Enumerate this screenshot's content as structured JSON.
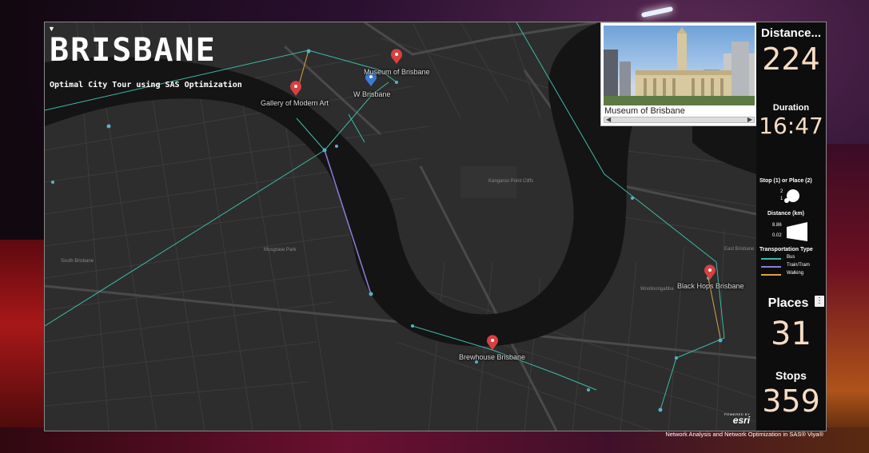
{
  "title": "BRISBANE",
  "subtitle": "Optimal City Tour using SAS Optimization",
  "footer": "Network Analysis and Network Optimization in SAS® Viya®",
  "photo_panel": {
    "caption": "Museum of Brisbane",
    "scroll_left": "◀",
    "scroll_right": "▶"
  },
  "poi": {
    "museum": "Museum of Brisbane",
    "w_brisbane": "W Brisbane",
    "gallery": "Gallery of Modern Art",
    "black_hops": "Black Hops Brisbane",
    "brewhouse": "Brewhouse Brisbane"
  },
  "map_labels": {
    "park1": "Musgrave Park",
    "park2": "Kangaroo Point Cliffs",
    "area1": "South Brisbane",
    "area2": "Woolloongabba",
    "area3": "East Brisbane"
  },
  "esri": {
    "powered": "POWERED BY",
    "name": "esri"
  },
  "stats": {
    "distance_label": "Distance...",
    "distance_value": "224",
    "duration_label": "Duration",
    "duration_value": "16:47",
    "places_label": "Places",
    "places_value": "31",
    "stops_label": "Stops",
    "stops_value": "359",
    "places_menu_icon": "⋮"
  },
  "legend": {
    "stop_place_heading": "Stop (1) or Place (2)",
    "stop_place_values": [
      "2",
      "1"
    ],
    "distance_heading": "Distance (km)",
    "distance_values": [
      "8.86",
      "0.02"
    ],
    "transport_heading": "Transportation Type",
    "transport": [
      {
        "label": "Bus",
        "color": "#3fb8a6"
      },
      {
        "label": "Train/Tram",
        "color": "#8a7fd6"
      },
      {
        "label": "Walking",
        "color": "#d9a441"
      }
    ]
  },
  "colors": {
    "poi_red": "#d94040",
    "poi_blue": "#3a7bd5",
    "river": "#141414",
    "land": "#2d2d2d"
  }
}
